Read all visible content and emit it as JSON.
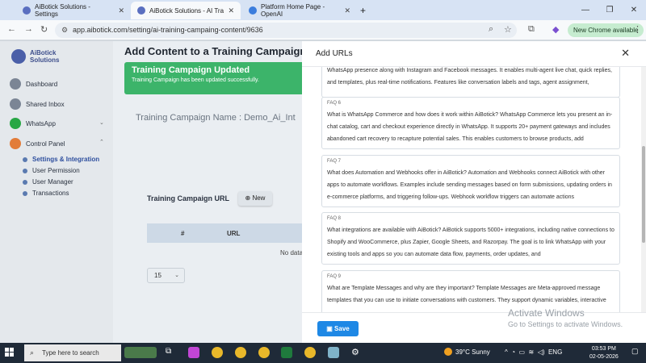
{
  "browser": {
    "tabs": [
      {
        "title": "AiBotick Solutions - Settings",
        "icon": "aibotick-favicon",
        "active": false
      },
      {
        "title": "AiBotick Solutions - AI Training",
        "icon": "aibotick-favicon",
        "active": true
      },
      {
        "title": "Platform Home Page - OpenAI",
        "icon": "openai-favicon",
        "active": false
      }
    ],
    "url": "app.aibotick.com/setting/ai-training-campaing-content/9636",
    "new_chrome_label": "New Chrome available"
  },
  "sidebar": {
    "logo_line1": "AiBotick",
    "logo_line2": "Solutions",
    "items": [
      {
        "label": "Dashboard",
        "icon": "dashboard-icon"
      },
      {
        "label": "Shared Inbox",
        "icon": "inbox-icon"
      },
      {
        "label": "WhatsApp",
        "icon": "whatsapp-icon"
      },
      {
        "label": "Control Panel",
        "icon": "control-panel-icon"
      }
    ],
    "subitems": [
      {
        "label": "Settings & Integration",
        "active": true
      },
      {
        "label": "User Permission",
        "active": false
      },
      {
        "label": "User Manager",
        "active": false
      },
      {
        "label": "Transactions",
        "active": false
      }
    ]
  },
  "main": {
    "title": "Add Content to a Training Campaign",
    "alert_title": "Training Campaign Updated",
    "alert_body": "Training Campaign has been updated successfully.",
    "campaign_name": "Training Campaign Name : Demo_Ai_Int",
    "url_section_title": "Training Campaign URL",
    "new_button": "New",
    "table_headers": [
      "#",
      "URL"
    ],
    "no_data": "No data",
    "page_size": "15"
  },
  "modal": {
    "title": "Add URLs",
    "save_label": "Save",
    "faqs": [
      {
        "label": "",
        "text": "WhatsApp presence along with Instagram and Facebook messages. It enables multi-agent live chat, quick replies, and templates, plus real-time notifications. Features like conversation labels and tags, agent assignment,"
      },
      {
        "label": "FAQ 6",
        "text": "What is WhatsApp Commerce and how does it work within AiBotick? WhatsApp Commerce lets you present an in-chat catalog, cart and checkout experience directly in WhatsApp. It supports 20+ payment gateways and includes abandoned cart recovery to recapture potential sales. This enables customers to browse products, add"
      },
      {
        "label": "FAQ 7",
        "text": "What does Automation and Webhooks offer in AiBotick? Automation and Webhooks connect AiBotick with other apps to automate workflows. Examples include sending messages based on form submissions, updating orders in e-commerce platforms, and triggering follow-ups. Webhook workflow triggers can automate actions"
      },
      {
        "label": "FAQ 8",
        "text": "What integrations are available with AiBotick? AiBotick supports 5000+ integrations, including native connections to Shopify and WooCommerce, plus Zapier, Google Sheets, and Razorpay. The goal is to link WhatsApp with your existing tools and apps so you can automate data flow, payments, order updates, and"
      },
      {
        "label": "FAQ 9",
        "text": "What are Template Messages and why are they important? Template Messages are Meta-approved message templates that you can use to initiate conversations with customers. They support dynamic variables, interactive"
      }
    ]
  },
  "watermark": {
    "line1": "Activate Windows",
    "line2": "Go to Settings to activate Windows."
  },
  "taskbar": {
    "search_placeholder": "Type here to search",
    "weather": "39°C  Sunny",
    "lang": "ENG",
    "time": "03:53 PM",
    "date": "02-05-2026"
  }
}
